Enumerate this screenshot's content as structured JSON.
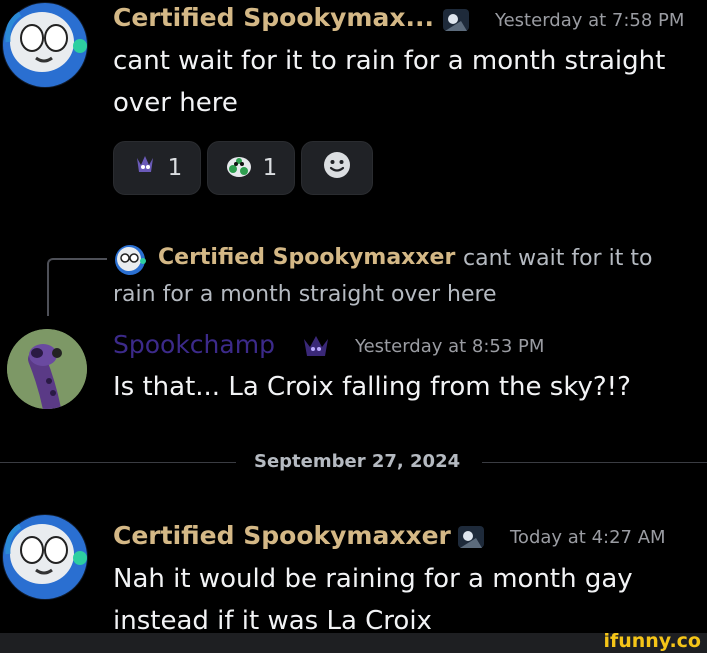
{
  "messages": [
    {
      "author": "Certified Spookymax...",
      "timestamp": "Yesterday at 7:58 PM",
      "line1": "cant wait for it to rain for a month straight",
      "line2": "over here",
      "name_color": "#d4b886"
    },
    {
      "author": "Spookchamp",
      "timestamp": "Yesterday at 8:53 PM",
      "line1": "Is that... La Croix falling from the sky?!?",
      "name_color": "#3c2a8a"
    },
    {
      "author": "Certified Spookymaxxer",
      "timestamp": "Today at 4:27 AM",
      "line1": "Nah it would be raining for a month gay",
      "line2": "instead if it was La Croix",
      "name_color": "#d4b886"
    }
  ],
  "reactions": [
    {
      "emoji": "purple-creature-emoji",
      "count": "1"
    },
    {
      "emoji": "green-spotted-creature-emoji",
      "count": "1"
    },
    {
      "emoji": "add-reaction-smiley-icon"
    }
  ],
  "reply": {
    "author": "Certified Spookymaxxer",
    "text_line1": "cant wait for it to",
    "text_line2": "rain for a month straight over here"
  },
  "divider": {
    "label": "September 27, 2024"
  },
  "watermark": "ifunny.co"
}
